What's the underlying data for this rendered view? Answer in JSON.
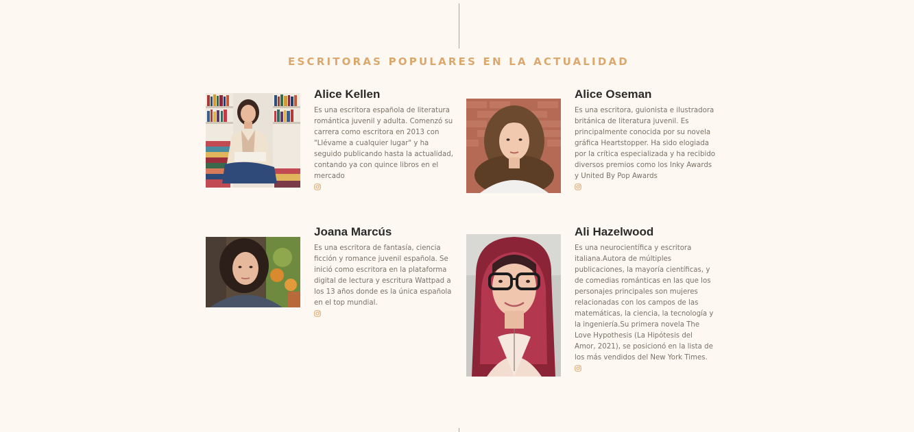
{
  "section": {
    "title": "ESCRITORAS POPULARES EN LA ACTUALIDAD"
  },
  "writers": [
    {
      "name": "Alice Kellen",
      "bio": "Es una escritora española de literatura romántica juvenil y adulta. Comenzó su carrera como escritora en 2013 con \"Llévame a cualquier lugar\" y ha seguido publicando hasta la actualidad, contando ya con quince libros en el mercado",
      "social_icon": "instagram-icon"
    },
    {
      "name": "Alice Oseman",
      "bio": "Es una escritora, guionista e ilustradora británica de literatura juvenil. Es principalmente conocida por su novela gráfica Heartstopper. Ha sido elogiada por la crítica especializada y ha recibido diversos premios como los Inky Awards y United By Pop Awards",
      "social_icon": "instagram-icon"
    },
    {
      "name": "Joana Marcús",
      "bio": "Es una escritora de fantasía, ciencia ficción y romance juvenil española. Se inició como escritora en la plataforma digital de lectura y escritura Wattpad a los 13 años donde es la única española en el top mundial.",
      "social_icon": "instagram-icon"
    },
    {
      "name": "Ali Hazelwood",
      "bio": "Es una neurocientífica y escritora italiana.Autora de múltiples publicaciones, la mayoría científicas, y de comedias románticas en las que los personajes principales son mujeres relacionadas con los campos de las matemáticas, la ciencia, la tecnología y la ingeniería.Su primera novela The Love Hypothesis (La Hipótesis del Amor, 2021), se posicionó en la lista de los más vendidos del New York Times.",
      "social_icon": "instagram-icon"
    }
  ],
  "colors": {
    "background": "#fdf9f2",
    "accent": "#dba76c",
    "divider": "#c7a06b",
    "name": "#2a2a2a",
    "body": "#7a7066"
  }
}
